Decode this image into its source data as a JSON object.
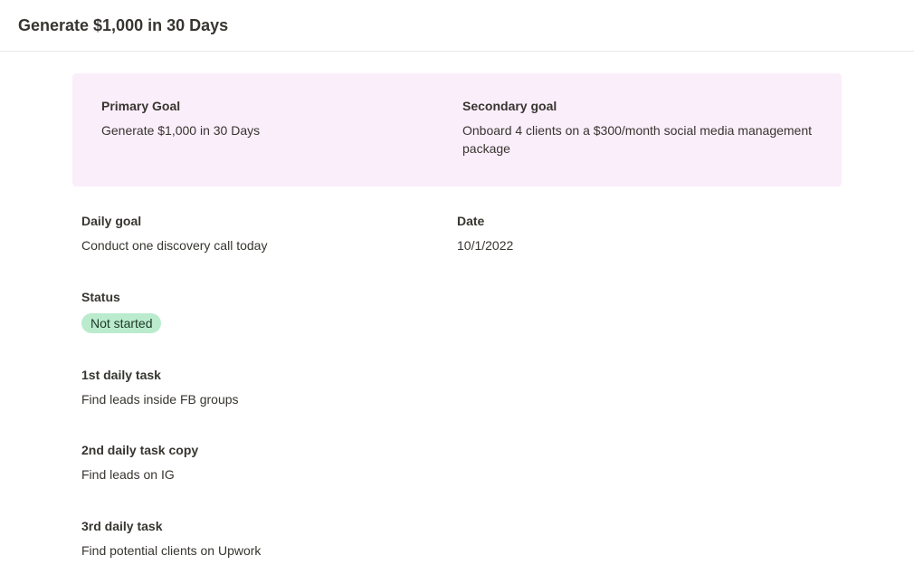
{
  "header": {
    "title": "Generate $1,000 in 30 Days"
  },
  "goals": {
    "primary_label": "Primary Goal",
    "primary_value": "Generate $1,000 in 30 Days",
    "secondary_label": "Secondary goal",
    "secondary_value": "Onboard 4 clients on a $300/month social media management package"
  },
  "daily": {
    "goal_label": "Daily goal",
    "goal_value": "Conduct one discovery call today",
    "date_label": "Date",
    "date_value": "10/1/2022"
  },
  "status": {
    "label": "Status",
    "value": "Not started"
  },
  "tasks": {
    "first_label": "1st daily task",
    "first_value": "Find leads inside FB groups",
    "second_label": "2nd daily task copy",
    "second_value": "Find leads on IG",
    "third_label": "3rd daily task",
    "third_value": "Find potential clients on Upwork"
  }
}
